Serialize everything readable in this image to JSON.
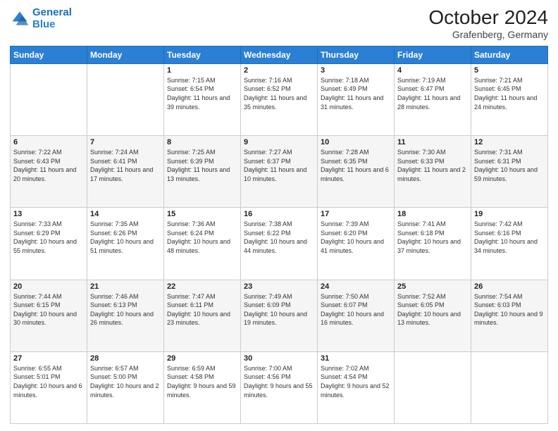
{
  "header": {
    "logo_line1": "General",
    "logo_line2": "Blue",
    "title": "October 2024",
    "subtitle": "Grafenberg, Germany"
  },
  "calendar": {
    "days_of_week": [
      "Sunday",
      "Monday",
      "Tuesday",
      "Wednesday",
      "Thursday",
      "Friday",
      "Saturday"
    ],
    "weeks": [
      [
        {
          "day": "",
          "sunrise": "",
          "sunset": "",
          "daylight": ""
        },
        {
          "day": "",
          "sunrise": "",
          "sunset": "",
          "daylight": ""
        },
        {
          "day": "1",
          "sunrise": "Sunrise: 7:15 AM",
          "sunset": "Sunset: 6:54 PM",
          "daylight": "Daylight: 11 hours and 39 minutes."
        },
        {
          "day": "2",
          "sunrise": "Sunrise: 7:16 AM",
          "sunset": "Sunset: 6:52 PM",
          "daylight": "Daylight: 11 hours and 35 minutes."
        },
        {
          "day": "3",
          "sunrise": "Sunrise: 7:18 AM",
          "sunset": "Sunset: 6:49 PM",
          "daylight": "Daylight: 11 hours and 31 minutes."
        },
        {
          "day": "4",
          "sunrise": "Sunrise: 7:19 AM",
          "sunset": "Sunset: 6:47 PM",
          "daylight": "Daylight: 11 hours and 28 minutes."
        },
        {
          "day": "5",
          "sunrise": "Sunrise: 7:21 AM",
          "sunset": "Sunset: 6:45 PM",
          "daylight": "Daylight: 11 hours and 24 minutes."
        }
      ],
      [
        {
          "day": "6",
          "sunrise": "Sunrise: 7:22 AM",
          "sunset": "Sunset: 6:43 PM",
          "daylight": "Daylight: 11 hours and 20 minutes."
        },
        {
          "day": "7",
          "sunrise": "Sunrise: 7:24 AM",
          "sunset": "Sunset: 6:41 PM",
          "daylight": "Daylight: 11 hours and 17 minutes."
        },
        {
          "day": "8",
          "sunrise": "Sunrise: 7:25 AM",
          "sunset": "Sunset: 6:39 PM",
          "daylight": "Daylight: 11 hours and 13 minutes."
        },
        {
          "day": "9",
          "sunrise": "Sunrise: 7:27 AM",
          "sunset": "Sunset: 6:37 PM",
          "daylight": "Daylight: 11 hours and 10 minutes."
        },
        {
          "day": "10",
          "sunrise": "Sunrise: 7:28 AM",
          "sunset": "Sunset: 6:35 PM",
          "daylight": "Daylight: 11 hours and 6 minutes."
        },
        {
          "day": "11",
          "sunrise": "Sunrise: 7:30 AM",
          "sunset": "Sunset: 6:33 PM",
          "daylight": "Daylight: 11 hours and 2 minutes."
        },
        {
          "day": "12",
          "sunrise": "Sunrise: 7:31 AM",
          "sunset": "Sunset: 6:31 PM",
          "daylight": "Daylight: 10 hours and 59 minutes."
        }
      ],
      [
        {
          "day": "13",
          "sunrise": "Sunrise: 7:33 AM",
          "sunset": "Sunset: 6:29 PM",
          "daylight": "Daylight: 10 hours and 55 minutes."
        },
        {
          "day": "14",
          "sunrise": "Sunrise: 7:35 AM",
          "sunset": "Sunset: 6:26 PM",
          "daylight": "Daylight: 10 hours and 51 minutes."
        },
        {
          "day": "15",
          "sunrise": "Sunrise: 7:36 AM",
          "sunset": "Sunset: 6:24 PM",
          "daylight": "Daylight: 10 hours and 48 minutes."
        },
        {
          "day": "16",
          "sunrise": "Sunrise: 7:38 AM",
          "sunset": "Sunset: 6:22 PM",
          "daylight": "Daylight: 10 hours and 44 minutes."
        },
        {
          "day": "17",
          "sunrise": "Sunrise: 7:39 AM",
          "sunset": "Sunset: 6:20 PM",
          "daylight": "Daylight: 10 hours and 41 minutes."
        },
        {
          "day": "18",
          "sunrise": "Sunrise: 7:41 AM",
          "sunset": "Sunset: 6:18 PM",
          "daylight": "Daylight: 10 hours and 37 minutes."
        },
        {
          "day": "19",
          "sunrise": "Sunrise: 7:42 AM",
          "sunset": "Sunset: 6:16 PM",
          "daylight": "Daylight: 10 hours and 34 minutes."
        }
      ],
      [
        {
          "day": "20",
          "sunrise": "Sunrise: 7:44 AM",
          "sunset": "Sunset: 6:15 PM",
          "daylight": "Daylight: 10 hours and 30 minutes."
        },
        {
          "day": "21",
          "sunrise": "Sunrise: 7:46 AM",
          "sunset": "Sunset: 6:13 PM",
          "daylight": "Daylight: 10 hours and 26 minutes."
        },
        {
          "day": "22",
          "sunrise": "Sunrise: 7:47 AM",
          "sunset": "Sunset: 6:11 PM",
          "daylight": "Daylight: 10 hours and 23 minutes."
        },
        {
          "day": "23",
          "sunrise": "Sunrise: 7:49 AM",
          "sunset": "Sunset: 6:09 PM",
          "daylight": "Daylight: 10 hours and 19 minutes."
        },
        {
          "day": "24",
          "sunrise": "Sunrise: 7:50 AM",
          "sunset": "Sunset: 6:07 PM",
          "daylight": "Daylight: 10 hours and 16 minutes."
        },
        {
          "day": "25",
          "sunrise": "Sunrise: 7:52 AM",
          "sunset": "Sunset: 6:05 PM",
          "daylight": "Daylight: 10 hours and 13 minutes."
        },
        {
          "day": "26",
          "sunrise": "Sunrise: 7:54 AM",
          "sunset": "Sunset: 6:03 PM",
          "daylight": "Daylight: 10 hours and 9 minutes."
        }
      ],
      [
        {
          "day": "27",
          "sunrise": "Sunrise: 6:55 AM",
          "sunset": "Sunset: 5:01 PM",
          "daylight": "Daylight: 10 hours and 6 minutes."
        },
        {
          "day": "28",
          "sunrise": "Sunrise: 6:57 AM",
          "sunset": "Sunset: 5:00 PM",
          "daylight": "Daylight: 10 hours and 2 minutes."
        },
        {
          "day": "29",
          "sunrise": "Sunrise: 6:59 AM",
          "sunset": "Sunset: 4:58 PM",
          "daylight": "Daylight: 9 hours and 59 minutes."
        },
        {
          "day": "30",
          "sunrise": "Sunrise: 7:00 AM",
          "sunset": "Sunset: 4:56 PM",
          "daylight": "Daylight: 9 hours and 55 minutes."
        },
        {
          "day": "31",
          "sunrise": "Sunrise: 7:02 AM",
          "sunset": "Sunset: 4:54 PM",
          "daylight": "Daylight: 9 hours and 52 minutes."
        },
        {
          "day": "",
          "sunrise": "",
          "sunset": "",
          "daylight": ""
        },
        {
          "day": "",
          "sunrise": "",
          "sunset": "",
          "daylight": ""
        }
      ]
    ]
  }
}
